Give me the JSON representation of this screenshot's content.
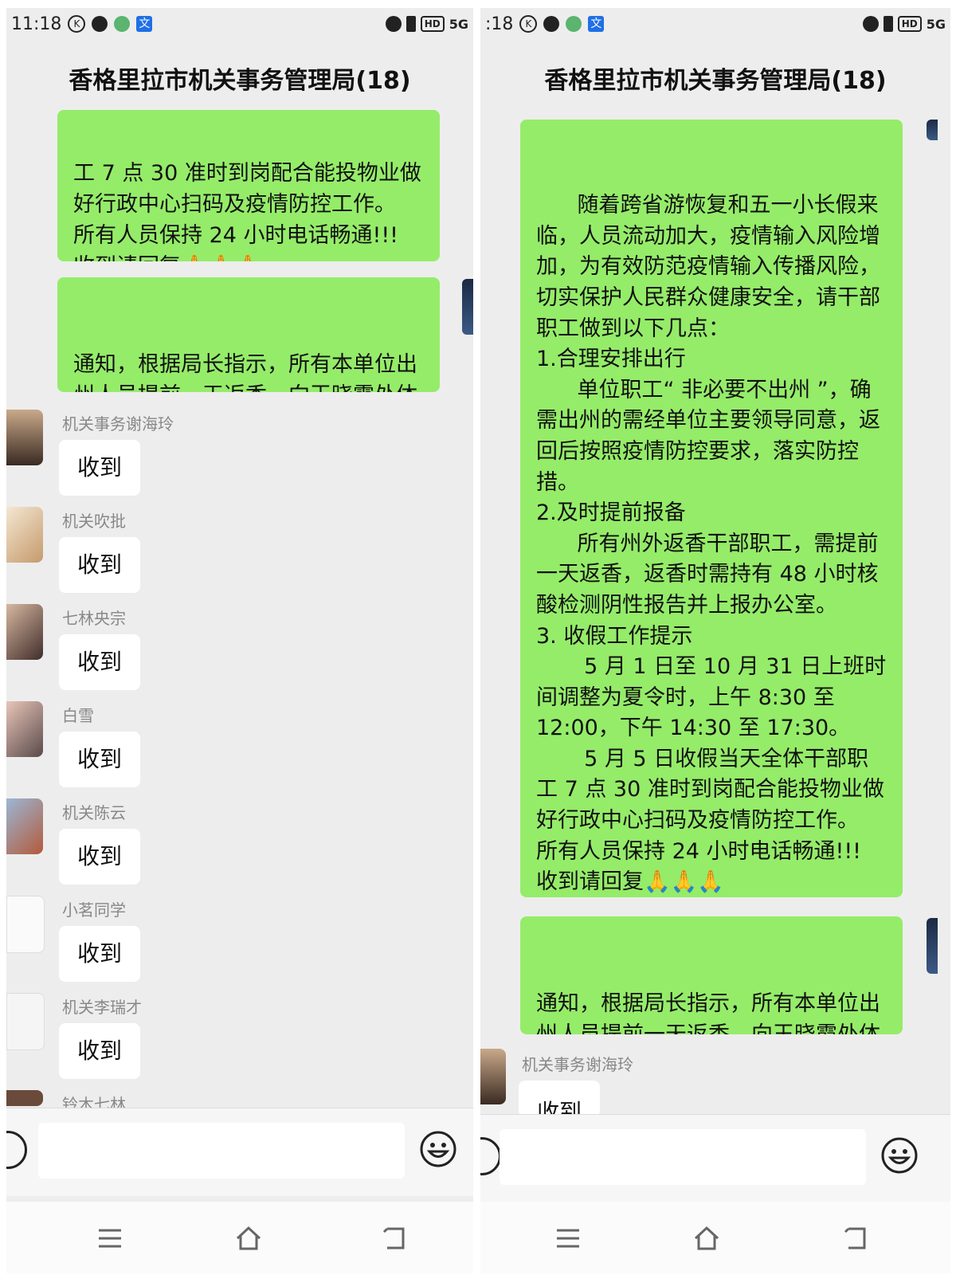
{
  "status": {
    "time_left": "11:18",
    "time_right": ":18",
    "network": "5G"
  },
  "chat": {
    "title": "香格里拉市机关事务管理局(18)"
  },
  "messages": {
    "left_top_tail": "工 7 点 30 准时到岗配合能投物业做好行政中心扫码及疫情防控工作。\n所有人员保持 24 小时电话畅通!!!\n收到请回复🙏🙏🙏",
    "notice": "通知，根据局长指示，所有本单位出州人员提前一天返香，向王晓霞处体检健康码及核酸检测表",
    "full": "      随着跨省游恢复和五一小长假来临，人员流动加大，疫情输入风险增加，为有效防范疫情输入传播风险，切实保护人民群众健康安全，请干部职工做到以下几点：\n1.合理安排出行\n      单位职工“ 非必要不出州 ”，确需出州的需经单位主要领导同意，返回后按照疫情防控要求，落实防控措。\n2.及时提前报备\n      所有州外返香干部职工，需提前一天返香，返香时需持有 48 小时核酸检测阴性报告并上报办公室。\n3. 收假工作提示\n       5 月 1 日至 10 月 31 日上班时间调整为夏令时，上午 8:30 至 12:00，下午 14:30 至 17:30。\n       5 月 5 日收假当天全体干部职工 7 点 30 准时到岗配合能投物业做好行政中心扫码及疫情防控工作。\n所有人员保持 24 小时电话畅通!!!\n收到请回复🙏🙏🙏"
  },
  "replies": [
    {
      "sender": "机关事务谢海玲",
      "text": "收到"
    },
    {
      "sender": "机关吹批",
      "text": "收到"
    },
    {
      "sender": "七林央宗",
      "text": "收到"
    },
    {
      "sender": "白雪",
      "text": "收到"
    },
    {
      "sender": "机关陈云",
      "text": "收到"
    },
    {
      "sender": "小茗同学",
      "text": "收到"
    },
    {
      "sender": "机关李瑞才",
      "text": "收到"
    },
    {
      "sender": "铃木七林",
      "text": ""
    }
  ],
  "composer": {
    "input_value": ""
  },
  "colors": {
    "bubble_self": "#95ec69",
    "chat_bg": "#ededed"
  },
  "icons": [
    "voice-icon",
    "emoji-icon",
    "menu-icon",
    "home-icon",
    "back-icon"
  ]
}
